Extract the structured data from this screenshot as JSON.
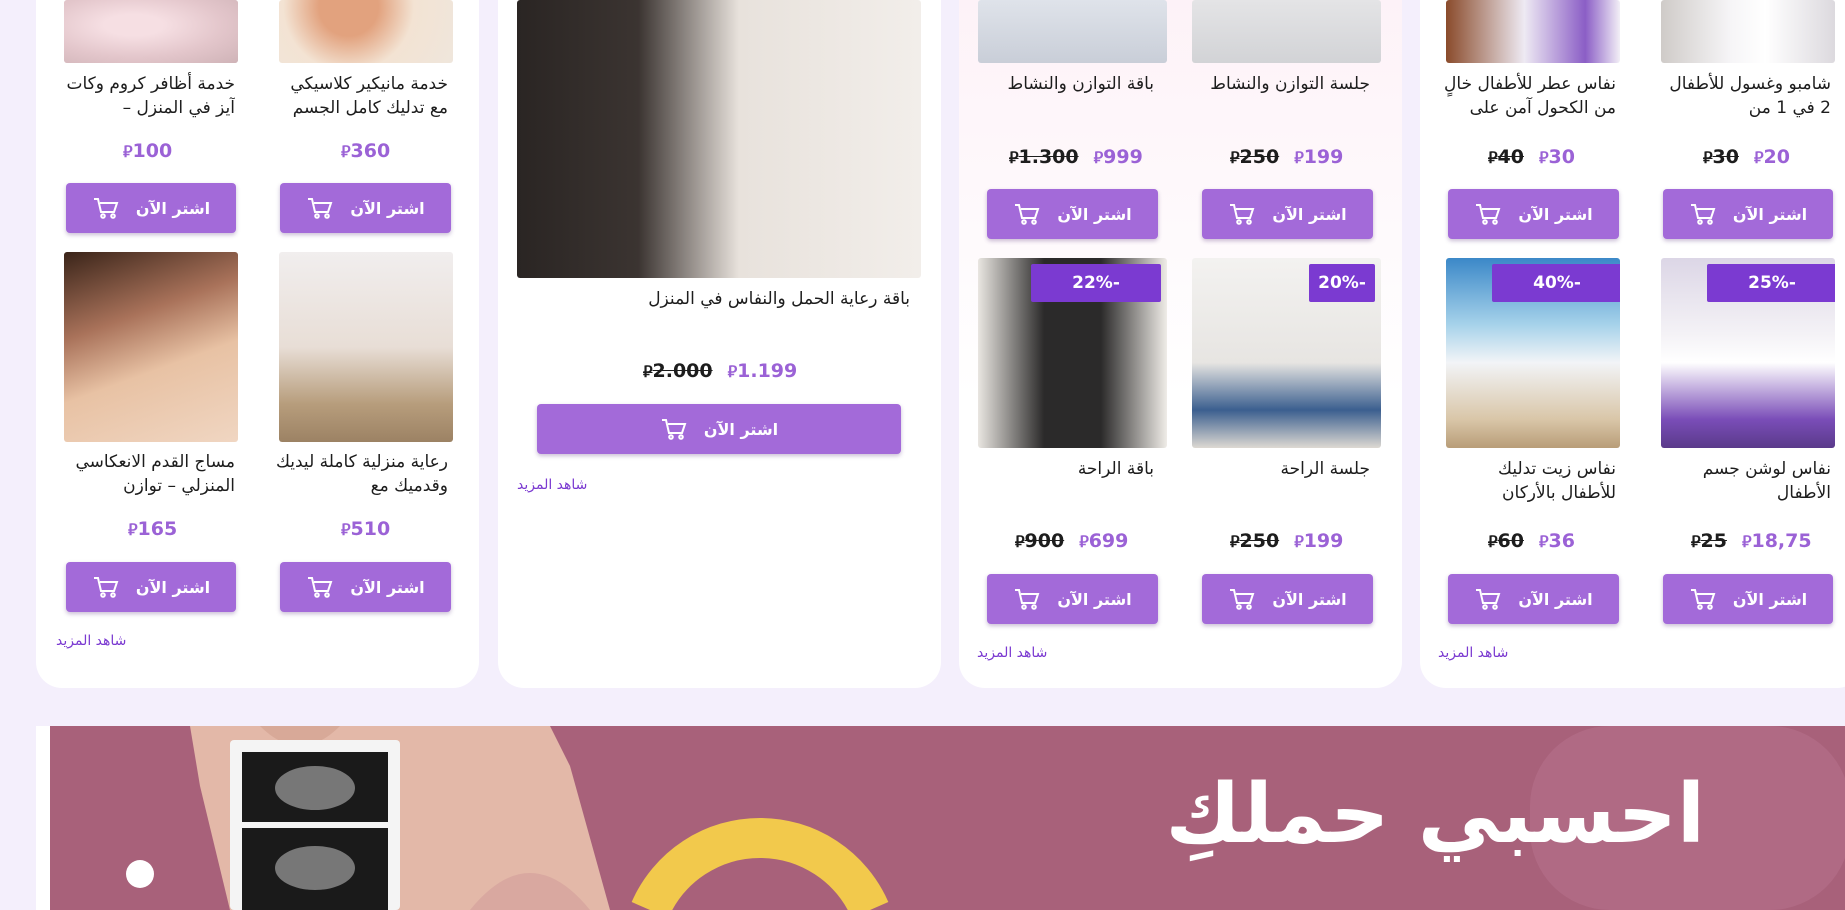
{
  "currency": "⃁",
  "buy_label": "اشتر الآن",
  "more_label": "شاهد المزيد",
  "colors": {
    "accent": "#a36ad9",
    "badge": "#7b3ad1",
    "banner": "#a8617a",
    "page_bg": "#f4effc"
  },
  "card1": {
    "products": [
      {
        "title": "خدمة أظافر كروم وكات آيز في المنزل –",
        "price": "100",
        "old": ""
      },
      {
        "title": "خدمة مانيكير كلاسيكي مع تدليك كامل الجسم",
        "price": "360",
        "old": ""
      },
      {
        "title": "مساج القدم الانعكاسي المنزلي – توازن",
        "price": "165",
        "old": ""
      },
      {
        "title": "رعاية منزلية كاملة ليديك وقدميك مع",
        "price": "510",
        "old": ""
      }
    ]
  },
  "card2": {
    "product": {
      "title": "باقة رعاية الحمل والنفاس في المنزل",
      "price": "1.199",
      "old": "2.000"
    }
  },
  "card3": {
    "products": [
      {
        "title": "باقة التوازن والنشاط",
        "price": "999",
        "old": "1.300",
        "badge": ""
      },
      {
        "title": "جلسة التوازن والنشاط",
        "price": "199",
        "old": "250",
        "badge": ""
      },
      {
        "title": "باقة الراحة",
        "price": "699",
        "old": "900",
        "badge": "22%-"
      },
      {
        "title": "جلسة الراحة",
        "price": "199",
        "old": "250",
        "badge": "20%-"
      }
    ]
  },
  "card4": {
    "products": [
      {
        "title": "نفاس عطر للأطفال خالٍ من الكحول آمن على",
        "price": "30",
        "old": "40",
        "badge": ""
      },
      {
        "title": "شامبو وغسول للأطفال 2 في 1 من",
        "price": "20",
        "old": "30",
        "badge": ""
      },
      {
        "title": "نفاس زيت تدليك للأطفال بالأركان",
        "price": "36",
        "old": "60",
        "badge": "40%-"
      },
      {
        "title": "نفاس لوشن جسم الأطفال",
        "price": "18,75",
        "old": "25",
        "badge": "25%-"
      }
    ]
  },
  "banner": {
    "headline": "احسبي حملكِ"
  }
}
